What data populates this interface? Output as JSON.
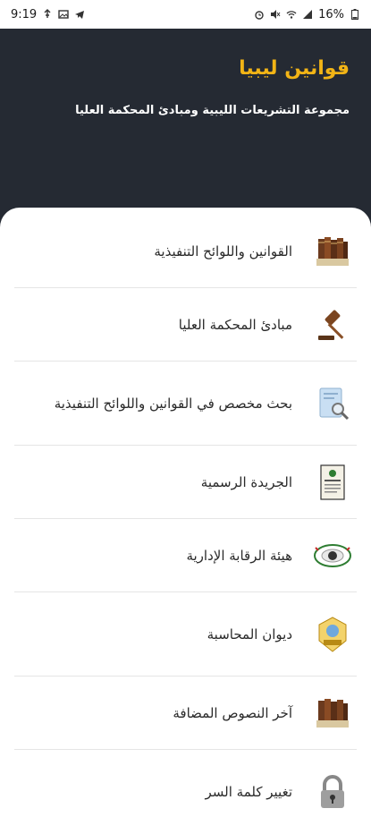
{
  "status_bar": {
    "time": "9:19",
    "battery": "16%"
  },
  "header": {
    "title": "قوانين ليبيا",
    "subtitle": "مجموعة التشريعات الليبية ومبادئ المحكمة العليا"
  },
  "menu": [
    {
      "label": "القوانين واللوائح التنفيذية",
      "icon": "law-books-icon"
    },
    {
      "label": "مبادئ المحكمة العليا",
      "icon": "gavel-icon"
    },
    {
      "label": "بحث مخصص في القوانين واللوائح التنفيذية",
      "icon": "document-search-icon"
    },
    {
      "label": "الجريدة الرسمية",
      "icon": "gazette-icon"
    },
    {
      "label": "هيئة الرقابة الإدارية",
      "icon": "administrative-control-emblem-icon"
    },
    {
      "label": "ديوان المحاسبة",
      "icon": "audit-bureau-emblem-icon"
    },
    {
      "label": "آخر النصوص المضافة",
      "icon": "recent-texts-books-icon"
    },
    {
      "label": "تغيير كلمة السر",
      "icon": "padlock-icon"
    }
  ],
  "colors": {
    "header_bg": "#252a33",
    "title": "#f2b416",
    "card_bg": "#ffffff",
    "divider": "#e5e5e5"
  }
}
